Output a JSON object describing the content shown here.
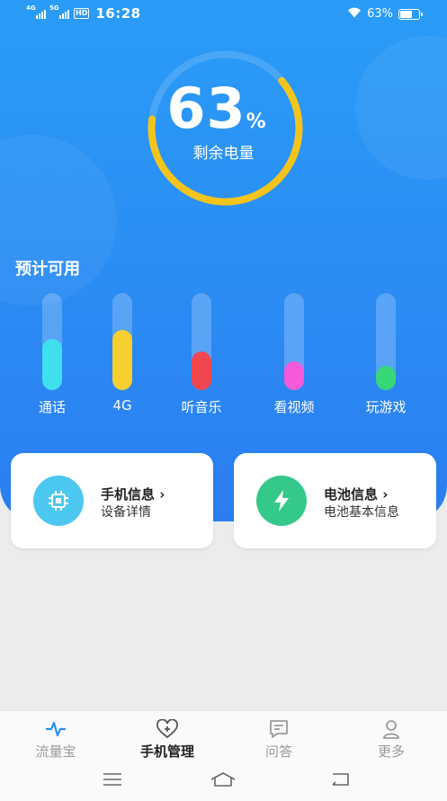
{
  "status_bar": {
    "signal_1": "4G",
    "signal_2": "5G",
    "hd": "HD",
    "time": "16:28",
    "battery_text": "63%",
    "battery_level": 0.63,
    "icons": [
      "wifi-icon",
      "battery-icon"
    ]
  },
  "gauge": {
    "value": "63",
    "unit": "%",
    "label": "剩余电量",
    "level": 0.63,
    "track_color": "#4aa6f7",
    "arc_color": "#f5c41c"
  },
  "estimate": {
    "title": "预计可用",
    "items": [
      {
        "label": "通话",
        "level": 0.53,
        "color": "#3ee0ee"
      },
      {
        "label": "4G",
        "level": 0.62,
        "color": "#f7cf2f"
      },
      {
        "label": "听音乐",
        "level": 0.4,
        "color": "#f2474e"
      },
      {
        "label": "看视频",
        "level": 0.3,
        "color": "#f45ad9"
      },
      {
        "label": "玩游戏",
        "level": 0.25,
        "color": "#38d77a"
      }
    ]
  },
  "cards": [
    {
      "title": "手机信息",
      "subtitle": "设备详情",
      "icon": "chip-icon",
      "color": "#4cc7ef"
    },
    {
      "title": "电池信息",
      "subtitle": "电池基本信息",
      "icon": "lightning-icon",
      "color": "#34c98a"
    }
  ],
  "tabs": [
    {
      "label": "流量宝",
      "icon": "pulse-icon",
      "active": false
    },
    {
      "label": "手机管理",
      "icon": "heart-plus-icon",
      "active": true
    },
    {
      "label": "问答",
      "icon": "message-icon",
      "active": false
    },
    {
      "label": "更多",
      "icon": "person-icon",
      "active": false
    }
  ],
  "nav": {
    "icons": [
      "menu-icon",
      "home-icon",
      "back-icon"
    ]
  }
}
